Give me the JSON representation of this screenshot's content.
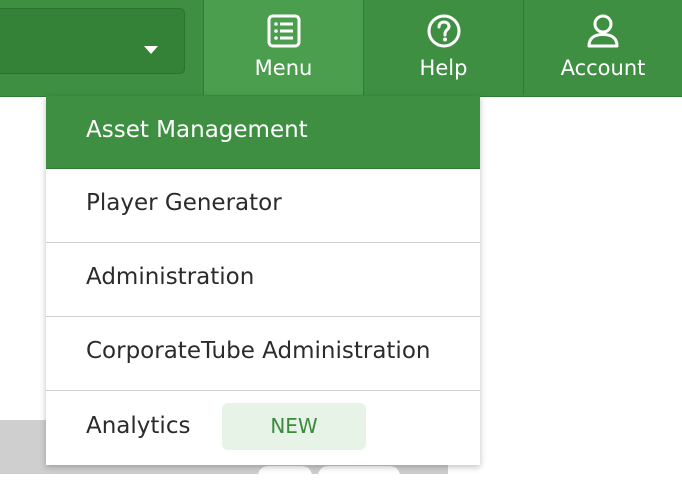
{
  "nav": {
    "menu_label": "Menu",
    "help_label": "Help",
    "account_label": "Account"
  },
  "dropdown": {
    "items": [
      {
        "label": "Asset Management",
        "active": true
      },
      {
        "label": "Player Generator"
      },
      {
        "label": "Administration"
      },
      {
        "label": "CorporateTube Administration"
      },
      {
        "label": "Analytics",
        "badge": "NEW"
      }
    ]
  },
  "colors": {
    "brand_green": "#3f8f43",
    "badge_bg": "#e6f3e6",
    "badge_text": "#3b8a3f"
  },
  "icons": {
    "menu": "list-icon",
    "help": "question-circle-icon",
    "account": "user-icon",
    "select": "caret-down-icon"
  }
}
